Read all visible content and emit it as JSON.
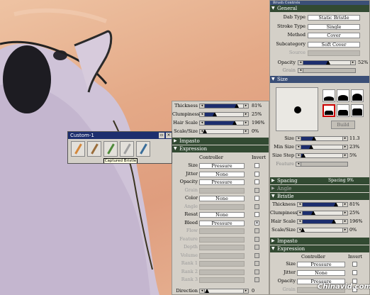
{
  "colors": {
    "panel_bg": "#d4d0c8",
    "section_green": "#324a32",
    "section_blue": "#3b4f77",
    "slider_fill": "#1d2e6e"
  },
  "mid_panel": {
    "sliders": [
      {
        "label": "Thickness",
        "value": "81%",
        "fraction": 0.81
      },
      {
        "label": "Clumpiness",
        "value": "25%",
        "fraction": 0.25
      },
      {
        "label": "Hair Scale",
        "value": "196%",
        "fraction": 0.75
      },
      {
        "label": "Scale/Size",
        "value": "0%",
        "fraction": 0.0
      }
    ],
    "impasto_header": "Impasto",
    "expression_header": "Expression",
    "col_controller": "Controller",
    "col_invert": "Invert",
    "rows": [
      {
        "label": "Size",
        "value": "Pressure",
        "enabled": true,
        "checked": false
      },
      {
        "label": "Jitter",
        "value": "None",
        "enabled": true,
        "checked": false
      },
      {
        "label": "Opacity",
        "value": "Pressure",
        "enabled": true,
        "checked": false
      },
      {
        "label": "Grain",
        "value": "",
        "enabled": false,
        "checked": false
      },
      {
        "label": "Color",
        "value": "None",
        "enabled": true,
        "checked": false
      },
      {
        "label": "Angle",
        "value": "",
        "enabled": false,
        "checked": false
      },
      {
        "label": "Resat",
        "value": "None",
        "enabled": true,
        "checked": false
      },
      {
        "label": "Bleed",
        "value": "Pressure",
        "enabled": true,
        "checked": true
      },
      {
        "label": "Flow",
        "value": "",
        "enabled": false,
        "checked": false
      },
      {
        "label": "Feature",
        "value": "",
        "enabled": false,
        "checked": false
      },
      {
        "label": "Depth",
        "value": "",
        "enabled": false,
        "checked": false
      },
      {
        "label": "Volume",
        "value": "",
        "enabled": false,
        "checked": false
      },
      {
        "label": "Rank 1",
        "value": "",
        "enabled": false,
        "checked": false
      },
      {
        "label": "Rank 2",
        "value": "",
        "enabled": false,
        "checked": false
      },
      {
        "label": "Rank 3",
        "value": "",
        "enabled": false,
        "checked": false
      }
    ],
    "direction_label": "Direction",
    "direction_value": "0"
  },
  "custom_palette": {
    "title": "Custom-1",
    "tooltip": "Captured Bristle"
  },
  "right_panel": {
    "title": "Brush Controls",
    "general_header": "General",
    "general_rows": [
      {
        "label": "Dab Type",
        "value": "Static Bristle",
        "enabled": true
      },
      {
        "label": "Stroke Type",
        "value": "Single",
        "enabled": true
      },
      {
        "label": "Method",
        "value": "Cover",
        "enabled": true
      },
      {
        "label": "Subcategory",
        "value": "Soft Cover",
        "enabled": true
      },
      {
        "label": "Source",
        "value": "",
        "enabled": false
      }
    ],
    "opacity": {
      "label": "Opacity",
      "value": "52%",
      "fraction": 0.52
    },
    "grain": {
      "label": "Grain"
    },
    "size_header": "Size",
    "build_label": "Build",
    "size_sliders": [
      {
        "label": "Size",
        "value": "11.3",
        "fraction": 0.3
      },
      {
        "label": "Min Size",
        "value": "23%",
        "fraction": 0.23
      },
      {
        "label": "Size Step",
        "value": "5%",
        "fraction": 0.05
      },
      {
        "label": "Feature",
        "value": "",
        "fraction": 0.0
      }
    ],
    "spacing_header": "Spacing",
    "spacing_value": "Spacing 9%",
    "angle_header": "Angle",
    "bristle_header": "Bristle",
    "bristle_sliders": [
      {
        "label": "Thickness",
        "value": "81%",
        "fraction": 0.81
      },
      {
        "label": "Clumpiness",
        "value": "25%",
        "fraction": 0.25
      },
      {
        "label": "Hair Scale",
        "value": "196%",
        "fraction": 0.75
      },
      {
        "label": "Scale/Size",
        "value": "0%",
        "fraction": 0.0
      }
    ],
    "impasto_header": "Impasto",
    "expression_header": "Expression",
    "col_controller": "Controller",
    "col_invert": "Invert",
    "expr_rows": [
      {
        "label": "Size",
        "value": "Pressure",
        "enabled": true
      },
      {
        "label": "Jitter",
        "value": "None",
        "enabled": true
      },
      {
        "label": "Opacity",
        "value": "Pressure",
        "enabled": true
      },
      {
        "label": "Grain",
        "value": "",
        "enabled": false
      }
    ]
  },
  "watermark": "Chinavid.com"
}
